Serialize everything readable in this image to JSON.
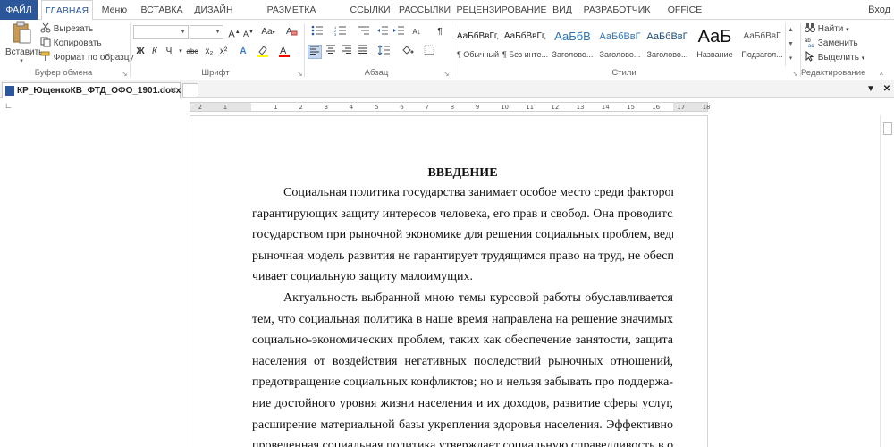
{
  "ribbon_tabs": [
    "ФАЙЛ",
    "ГЛАВНАЯ",
    "Меню",
    "ВСТАВКА",
    "ДИЗАЙН",
    "РАЗМЕТКА СТРАНИЦЫ",
    "ССЫЛКИ",
    "РАССЫЛКИ",
    "РЕЦЕНЗИРОВАНИЕ",
    "ВИД",
    "РАЗРАБОТЧИК",
    "OFFICE TAB"
  ],
  "active_tab": "ГЛАВНАЯ",
  "login_label": "Вход",
  "clipboard": {
    "paste": "Вставить",
    "cut": "Вырезать",
    "copy": "Копировать",
    "format_painter": "Формат по образцу",
    "group_label": "Буфер обмена"
  },
  "font": {
    "name_value": "",
    "size_value": "",
    "grow": "A",
    "shrink": "A",
    "change_case": "Aa",
    "bold": "Ж",
    "italic": "К",
    "underline": "Ч",
    "strikethrough": "abc",
    "subscript": "x₂",
    "superscript": "x²",
    "group_label": "Шрифт"
  },
  "paragraph": {
    "group_label": "Абзац"
  },
  "styles": {
    "items": [
      {
        "sample": "АаБбВвГг,",
        "name": "¶ Обычный"
      },
      {
        "sample": "АаБбВвГг,",
        "name": "¶ Без инте..."
      },
      {
        "sample": "АаБбВ",
        "name": "Заголово..."
      },
      {
        "sample": "АаБбВвГ",
        "name": "Заголово..."
      },
      {
        "sample": "АаБбВвГ",
        "name": "Заголово..."
      },
      {
        "sample": "АаБ",
        "name": "Название"
      },
      {
        "sample": "АаБбВвГ",
        "name": "Подзагол..."
      }
    ],
    "group_label": "Стили"
  },
  "editing": {
    "find": "Найти",
    "replace": "Заменить",
    "select": "Выделить",
    "group_label": "Редактирование"
  },
  "document_tab": {
    "name": "КР_ЮщенкоКВ_ФТД_ОФО_1901.docx"
  },
  "ruler_ticks": [
    "2",
    "1",
    "1",
    "2",
    "3",
    "4",
    "5",
    "6",
    "7",
    "8",
    "9",
    "10",
    "11",
    "12",
    "13",
    "14",
    "15",
    "16",
    "17",
    "18"
  ],
  "document": {
    "heading": "ВВЕДЕНИЕ",
    "lines": [
      "Социальная политика государства занимает особое место среди факторов",
      "гарантирующих защиту интересов человека, его прав и свобод. Она проводится",
      "государством при рыночной экономике для решения социальных проблем, ведь",
      "рыночная модель развития не гарантирует трудящимся право на труд, не обеспе-",
      "чивает социальную защиту малоимущих.",
      "Актуальность выбранной мною темы курсовой работы обуславливается",
      "тем, что социальная политика в наше время направлена на решение значимых",
      "социально-экономических проблем, таких как обеспечение занятости, защита",
      "населения от воздействия негативных последствий рыночных отношений,",
      "предотвращение социальных конфликтов; но и нельзя забывать про поддержа-",
      "ние достойного уровня жизни населения и их доходов, развитие сферы услуг,",
      "расширение материальной базы укрепления здоровья населения. Эффективно",
      "проведенная социальная политика утверждает социальную справедливость в об-"
    ]
  },
  "colors": {
    "file_tab": "#2b579a",
    "accent": "#2b579a",
    "highlight": "#ffff00",
    "font_color": "#ff0000"
  }
}
